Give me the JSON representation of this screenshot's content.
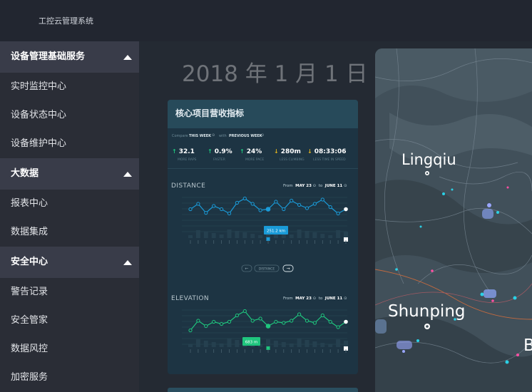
{
  "app": {
    "title": "工控云管理系统"
  },
  "sidebar": {
    "groups": [
      {
        "label": "设备管理基础服务",
        "items": [
          "实时监控中心",
          "设备状态中心",
          "设备维护中心"
        ]
      },
      {
        "label": "大数据",
        "items": [
          "报表中心",
          "数据集成"
        ]
      },
      {
        "label": "安全中心",
        "items": [
          "警告记录",
          "安全管家",
          "数据风控",
          "加密服务"
        ]
      }
    ]
  },
  "main": {
    "date": "2018 年 1 月 1 日"
  },
  "panel": {
    "title": "核心项目营收指标",
    "compare": {
      "label": "Compare",
      "this_week": "THIS WEEK",
      "with": "with",
      "previous_week": "PREVIOUS WEEK"
    },
    "stats": [
      {
        "value": "32.1",
        "sub": "MORE RAPS",
        "dir": "up"
      },
      {
        "value": "0.9%",
        "sub": "FASTER",
        "dir": "up"
      },
      {
        "value": "24%",
        "sub": "MORE PACE",
        "dir": "up"
      },
      {
        "value": "280m",
        "sub": "LESS CLIMBING",
        "dir": "down"
      },
      {
        "value": "08:33:06",
        "sub": "LESS TIME IN SPEED",
        "dir": "down"
      }
    ],
    "distance": {
      "title": "DISTANCE",
      "from_label": "From",
      "from": "MAY 23",
      "to_label": "to",
      "to": "JUNE 11",
      "tooltip": "251.2 km",
      "pager_label": "DISTANCE"
    },
    "elevation": {
      "title": "ELEVATION",
      "from_label": "From",
      "from": "MAY 23",
      "to_label": "to",
      "to": "JUNE 11",
      "tooltip": "683 m"
    }
  },
  "map": {
    "places": [
      "Lingqiu",
      "Shunping",
      "B"
    ]
  },
  "colors": {
    "accent_blue": "#1a9bd8",
    "accent_green": "#1fc67e",
    "sidebar_group_bg": "#393c49",
    "panel_bg": "#1d3443"
  }
}
